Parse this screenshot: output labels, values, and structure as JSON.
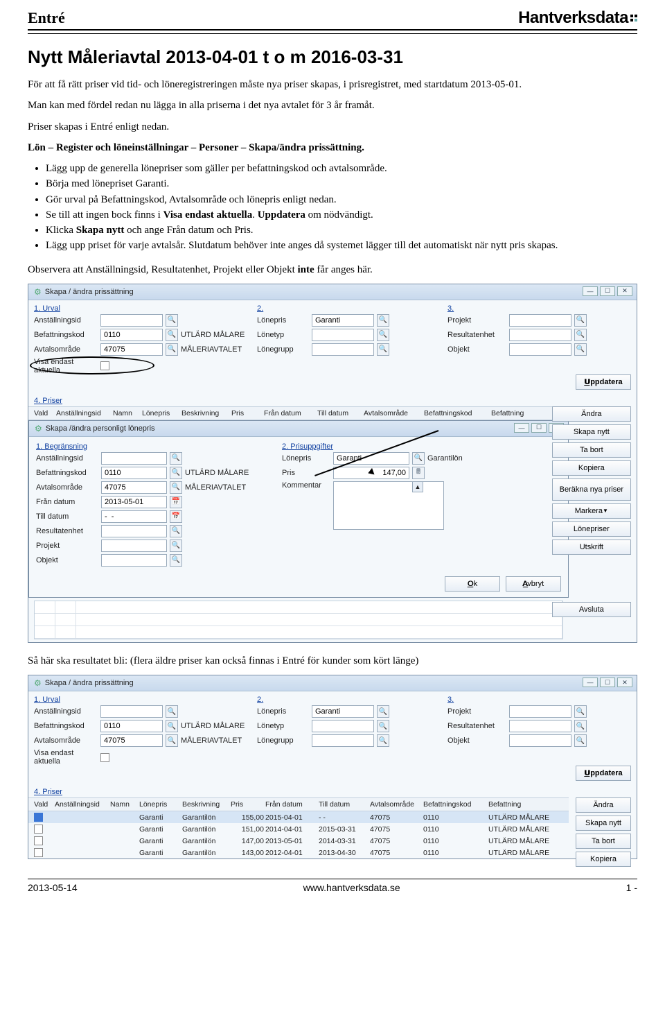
{
  "header": {
    "left": "Entré",
    "right": "Hantverksdata"
  },
  "title": "Nytt Måleriavtal 2013-04-01 t o m 2016-03-31",
  "intro1": "För att få rätt priser vid tid- och löneregistreringen måste nya priser skapas, i prisregistret, med startdatum 2013-05-01.",
  "intro2": "Man kan med fördel redan nu lägga in alla priserna i det nya avtalet för 3 år framåt.",
  "intro3": "Priser skapas i Entré enligt nedan.",
  "path": "Lön – Register och löneinställningar – Personer – Skapa/ändra prissättning.",
  "bullets": [
    "Lägg upp de generella lönepriser som gäller per befattningskod och avtalsområde.",
    "Börja med lönepriset Garanti.",
    "Gör urval på Befattningskod, Avtalsområde och lönepris enligt nedan.",
    "Se till att ingen bock finns i Visa endast aktuella. Uppdatera om nödvändigt.",
    "Klicka Skapa nytt och ange Från datum och Pris.",
    "Lägg upp priset för varje avtalsår. Slutdatum behöver inte anges då systemet lägger till det automatiskt när nytt pris skapas."
  ],
  "bullets_bold": {
    "3_a": "Visa endast aktuella",
    "3_b": "Uppdatera",
    "4_a": "Skapa nytt"
  },
  "observe_pre": "Observera att Anställningsid, Resultatenhet, Projekt eller Objekt ",
  "observe_bold": "inte",
  "observe_post": " får anges här.",
  "win1": {
    "title": "Skapa / ändra prissättning",
    "sec1": "1. Urval",
    "sec2": "2.",
    "sec3": "3.",
    "sec4": "4. Priser",
    "labels": {
      "anst": "Anställningsid",
      "bef": "Befattningskod",
      "avt": "Avtalsområde",
      "visa": "Visa endast aktuella",
      "lonep": "Lönepris",
      "lonet": "Lönetyp",
      "loneg": "Lönegrupp",
      "proj": "Projekt",
      "res": "Resultatenhet",
      "obj": "Objekt"
    },
    "vals": {
      "bef": "0110",
      "bef_desc": "UTLÄRD MÅLARE",
      "avt": "47075",
      "avt_desc": "MÅLERIAVTALET",
      "lonep": "Garanti"
    },
    "uppdatera": "Uppdatera",
    "price_cols": [
      "Vald",
      "Anställningsid",
      "Namn",
      "Lönepris",
      "Beskrivning",
      "Pris",
      "Från datum",
      "Till datum",
      "Avtalsområde",
      "Befattningskod",
      "Befattning"
    ],
    "sidebtns": [
      "Ändra",
      "Skapa nytt",
      "Ta bort",
      "Kopiera",
      "Beräkna nya priser",
      "Markera",
      "Lönepriser",
      "Utskrift"
    ],
    "avsluta": "Avsluta"
  },
  "win2": {
    "title": "Skapa /ändra personligt lönepris",
    "sec1": "1. Begränsning",
    "sec2": "2. Prisuppgifter",
    "labels": {
      "anst": "Anställningsid",
      "bef": "Befattningskod",
      "avt": "Avtalsområde",
      "fran": "Från datum",
      "till": "Till datum",
      "res": "Resultatenhet",
      "proj": "Projekt",
      "obj": "Objekt",
      "lonep": "Lönepris",
      "pris": "Pris",
      "komm": "Kommentar"
    },
    "vals": {
      "bef": "0110",
      "bef_desc": "UTLÄRD MÅLARE",
      "avt": "47075",
      "avt_desc": "MÅLERIAVTALET",
      "fran": "2013-05-01",
      "till": "-  -",
      "lonep": "Garanti",
      "lonep_desc": "Garantilön",
      "pris": "147,00"
    },
    "ok": "Ok",
    "avbryt": "Avbryt"
  },
  "mid_text": "Så här ska resultatet bli: (flera äldre priser kan också finnas i Entré för kunder som kört länge)",
  "win3": {
    "rows": [
      {
        "lp": "Garanti",
        "bes": "Garantilön",
        "pris": "155,00",
        "fran": "2015-04-01",
        "till": "-  -",
        "avt": "47075",
        "bef": "0110",
        "befn": "UTLÄRD MÅLARE"
      },
      {
        "lp": "Garanti",
        "bes": "Garantilön",
        "pris": "151,00",
        "fran": "2014-04-01",
        "till": "2015-03-31",
        "avt": "47075",
        "bef": "0110",
        "befn": "UTLÄRD MÅLARE"
      },
      {
        "lp": "Garanti",
        "bes": "Garantilön",
        "pris": "147,00",
        "fran": "2013-05-01",
        "till": "2014-03-31",
        "avt": "47075",
        "bef": "0110",
        "befn": "UTLÄRD MÅLARE"
      },
      {
        "lp": "Garanti",
        "bes": "Garantilön",
        "pris": "143,00",
        "fran": "2012-04-01",
        "till": "2013-04-30",
        "avt": "47075",
        "bef": "0110",
        "befn": "UTLÄRD MÅLARE"
      }
    ],
    "sidebtns": [
      "Ändra",
      "Skapa nytt",
      "Ta bort",
      "Kopiera"
    ]
  },
  "footer": {
    "left": "2013-05-14",
    "center": "www.hantverksdata.se",
    "right": "1 -"
  }
}
